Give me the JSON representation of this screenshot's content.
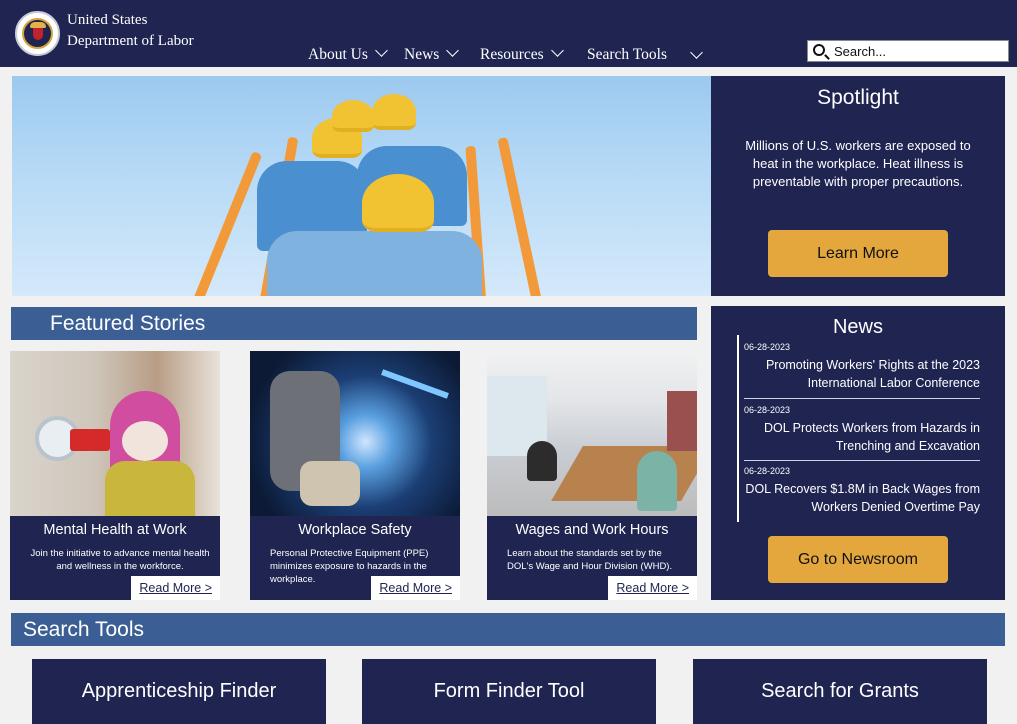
{
  "header": {
    "agency_line1": "United States",
    "agency_line2": "Department of Labor",
    "nav": [
      "About Us",
      "News",
      "Resources",
      "Search Tools"
    ],
    "search_placeholder": "Search..."
  },
  "spotlight": {
    "heading": "Spotlight",
    "text": "Millions of U.S. workers are exposed to heat in the workplace. Heat illness is preventable with proper precautions.",
    "button": "Learn More"
  },
  "featured": {
    "heading": "Featured Stories",
    "stories": [
      {
        "title": "Mental Health at Work",
        "text": "Join the initiative to advance mental health and wellness in the workforce.",
        "link": "Read More >"
      },
      {
        "title": "Workplace Safety",
        "text": "Personal Protective Equipment (PPE) minimizes exposure to hazards in the workplace.",
        "link": "Read More >"
      },
      {
        "title": "Wages and Work Hours",
        "text": "Learn about the standards set by the DOL's Wage and Hour Division (WHD).",
        "link": "Read More >"
      }
    ]
  },
  "news": {
    "heading": "News",
    "items": [
      {
        "date": "06-28-2023",
        "title": "Promoting Workers' Rights at the 2023 International Labor Conference"
      },
      {
        "date": "06-28-2023",
        "title": "DOL Protects Workers from Hazards in Trenching and Excavation"
      },
      {
        "date": "06-28-2023",
        "title": "DOL Recovers $1.8M in Back Wages from Workers Denied Overtime Pay"
      }
    ],
    "button": "Go to Newsroom"
  },
  "search_tools": {
    "heading": "Search Tools",
    "cards": [
      "Apprenticeship Finder",
      "Form Finder Tool",
      "Search for Grants"
    ]
  },
  "colors": {
    "navy": "#1f2451",
    "section_blue": "#3b5f95",
    "gold": "#e3a73d"
  }
}
